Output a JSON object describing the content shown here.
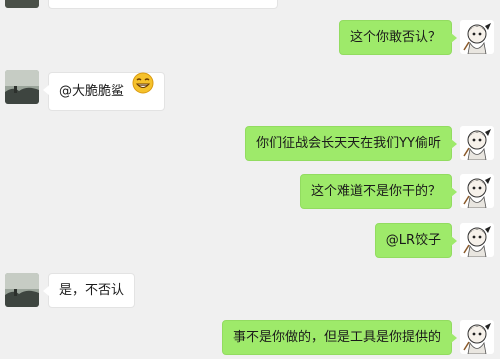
{
  "messages": [
    {
      "side": "in",
      "text": "",
      "partial": true
    },
    {
      "side": "out",
      "text": "这个你敢否认？"
    },
    {
      "side": "in",
      "text": "@大脆脆鲨",
      "emoji": "grinning-smile-icon"
    },
    {
      "side": "out",
      "text": "你们征战会长天天在我们YY偷听"
    },
    {
      "side": "out",
      "text": "这个难道不是你干的？"
    },
    {
      "side": "out",
      "text": "@LR饺子"
    },
    {
      "side": "in",
      "text": "是，不否认"
    },
    {
      "side": "out",
      "text": "事不是你做的，但是工具是你提供的"
    }
  ],
  "colors": {
    "background": "#f0f0f0",
    "outgoing_bubble": "#9eea6a",
    "incoming_bubble": "#ffffff"
  },
  "icons": {
    "incoming_avatar": "landscape-avatar-icon",
    "outgoing_avatar": "cartoon-character-avatar-icon"
  }
}
